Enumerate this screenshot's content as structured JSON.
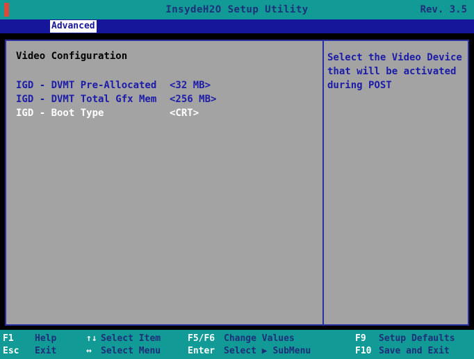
{
  "title": "InsydeH2O Setup Utility",
  "revision": "Rev. 3.5",
  "menu": {
    "active_tab": "Advanced"
  },
  "page": {
    "section_title": "Video Configuration",
    "settings": [
      {
        "label": "IGD - DVMT Pre-Allocated",
        "value": "<32 MB>",
        "selected": false
      },
      {
        "label": "IGD - DVMT Total Gfx Mem",
        "value": "<256 MB>",
        "selected": false
      },
      {
        "label": "IGD - Boot Type",
        "value": "<CRT>",
        "selected": true
      }
    ],
    "help_text": "Select the Video Device that will be activated during POST"
  },
  "footer": {
    "row1": [
      {
        "key": "F1",
        "desc": "Help"
      },
      {
        "key": "↑↓",
        "desc": "Select Item"
      },
      {
        "key": "F5/F6",
        "desc": "Change Values"
      },
      {
        "key": "F9",
        "desc": "Setup Defaults"
      }
    ],
    "row2": [
      {
        "key": "Esc",
        "desc": "Exit"
      },
      {
        "key": "↔",
        "desc": "Select Menu"
      },
      {
        "key": "Enter",
        "desc": "Select ▶ SubMenu"
      },
      {
        "key": "F10",
        "desc": "Save and Exit"
      }
    ]
  },
  "colors": {
    "title_bar": "#129a96",
    "menu_bar": "#16169a",
    "panel": "#a3a3a3",
    "value_text": "#1c1ca8",
    "selected_text": "#ffffff"
  }
}
